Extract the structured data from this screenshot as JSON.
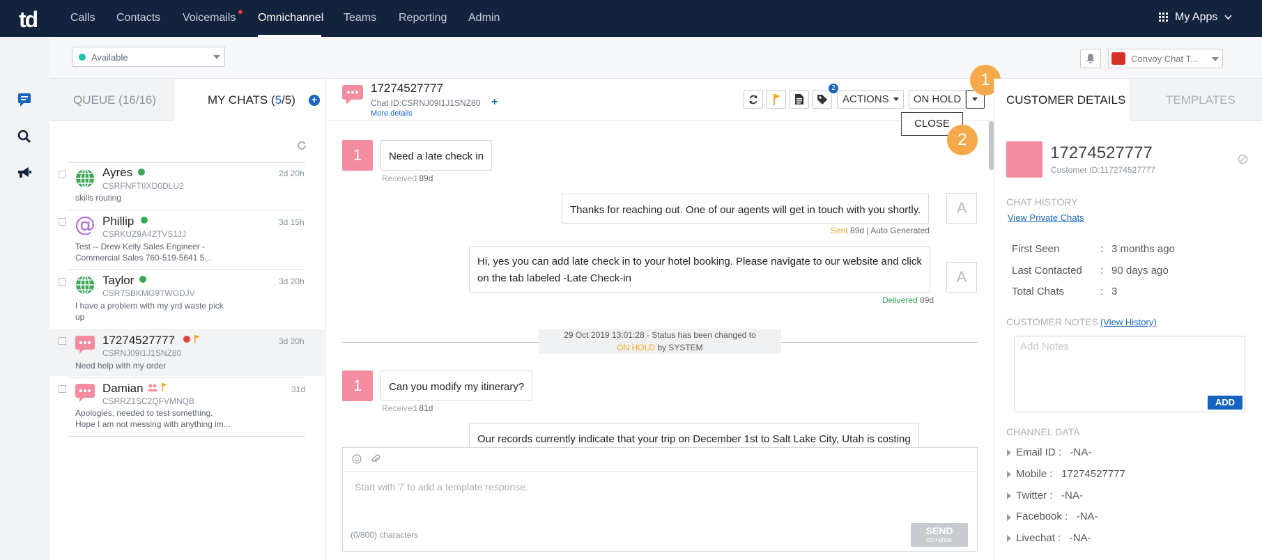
{
  "app": {
    "logo": "td"
  },
  "nav": {
    "items": [
      "Calls",
      "Contacts",
      "Voicemails",
      "Omnichannel",
      "Teams",
      "Reporting",
      "Admin"
    ],
    "active": "Omnichannel",
    "my_apps": "My Apps"
  },
  "status": {
    "availability": "Available",
    "channel_select": "Convoy Chat T..."
  },
  "list": {
    "tab_queue": "QUEUE (16/16)",
    "tab_mychats_prefix": "MY CHATS (",
    "tab_mychats_count": "5",
    "tab_mychats_sep": "/5)",
    "chats": [
      {
        "name": "Ayres",
        "id": "CSRFNFTIIXD0DLU2",
        "msg1": "skills routing",
        "msg2": "",
        "time": "2d 20h",
        "icon": "globe-icon"
      },
      {
        "name": "Phillip",
        "id": "CSRKUZ9A4ZTVS1JJ",
        "msg1": "Test -- Drew Kelly Sales Engineer -",
        "msg2": "Commercial Sales 760-519-5641 5...",
        "time": "3d 15h",
        "icon": "at-icon"
      },
      {
        "name": "Taylor",
        "id": "CSR7SBKMG9TWODJV",
        "msg1": "I have a problem with my yrd waste pick",
        "msg2": "up",
        "time": "3d 20h",
        "icon": "globe-icon"
      },
      {
        "name": "17274527777",
        "id": "CSRNJ09I1J1SNZ80",
        "msg1": "Need help with my order",
        "msg2": "",
        "time": "3d 20h",
        "icon": "sms-chat-icon"
      },
      {
        "name": "Damian",
        "id": "CSRRZ1SC2QFVMNQB",
        "msg1": "Apologies, needed to test something.",
        "msg2": "Hope I am not messing with anything im...",
        "time": "31d",
        "icon": "sms-chat-icon"
      }
    ]
  },
  "conversation": {
    "phone": "17274527777",
    "chat_id": "Chat ID:CSRNJ09I1J1SNZ80",
    "more_details": "More details",
    "tag_badge": "2",
    "actions_label": "ACTIONS",
    "on_hold_label": "ON HOLD",
    "close_label": "CLOSE",
    "steps": [
      "1",
      "2"
    ],
    "messages": [
      {
        "dir": "in",
        "tile": "1",
        "text": "Need a late check in",
        "status": "Received",
        "age": "89d"
      },
      {
        "dir": "out",
        "tile": "A",
        "text": "Thanks for reaching out. One of our agents will get in touch with you shortly.",
        "status": "Sent",
        "age": "89d",
        "extra": "| Auto Generated"
      },
      {
        "dir": "out",
        "tile": "A",
        "text1": "Hi, yes you can add late check in to your hotel booking. Please navigate to our website and click",
        "text2": "on the tab labeled -Late Check-in",
        "status": "Delivered",
        "age": "89d"
      },
      {
        "dir": "in",
        "tile": "1",
        "text": "Can you modify my itinerary?",
        "status": "Received",
        "age": "81d"
      },
      {
        "dir": "out",
        "text": "Our records currently indicate that your trip on December 1st to Salt Lake City, Utah is costing"
      }
    ],
    "system": {
      "line1": "29 Oct 2019 13:01:28 - Status has been changed to",
      "status": "ON HOLD",
      "suffix": "by SYSTEM"
    },
    "composer": {
      "placeholder": "Start with '/' to add a template response.",
      "count": "(0/800) characters",
      "send": "SEND",
      "send_hint": "ctrl+enter"
    }
  },
  "customer": {
    "tab_details": "CUSTOMER DETAILS",
    "tab_templates": "TEMPLATES",
    "phone": "17274527777",
    "customer_id": "Customer ID:117274527777",
    "chat_history_title": "CHAT HISTORY",
    "view_private": "View Private Chats",
    "first_seen_label": "First Seen",
    "first_seen": "3 months ago",
    "last_contacted_label": "Last Contacted",
    "last_contacted": "90 days ago",
    "total_chats_label": "Total Chats",
    "total_chats": "3",
    "notes_title": "CUSTOMER NOTES",
    "view_history": "(View History)",
    "notes_placeholder": "Add Notes",
    "add_label": "ADD",
    "channel_title": "CHANNEL DATA",
    "channels": [
      {
        "label": "Email ID",
        "value": "-NA-"
      },
      {
        "label": "Mobile",
        "value": "17274527777"
      },
      {
        "label": "Twitter",
        "value": "-NA-"
      },
      {
        "label": "Facebook",
        "value": "-NA-"
      },
      {
        "label": "Livechat",
        "value": "-NA-"
      }
    ]
  },
  "colors": {
    "nav_bg": "#13223d",
    "accent": "#1565c0",
    "brand_pink": "#f48ca0",
    "on_hold": "#f5a623",
    "delivered": "#3aa757",
    "step_orange": "#f6a94a"
  }
}
